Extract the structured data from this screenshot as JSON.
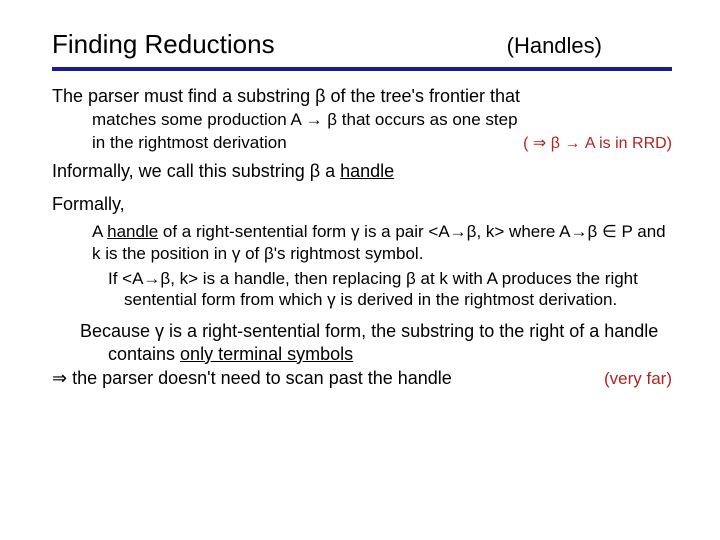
{
  "title": "Finding Reductions",
  "subtitle": "(Handles)",
  "line1": "The parser must find a substring β of the tree's frontier that",
  "line1a": "matches some production A → β that occurs as one step",
  "line1b_left": "in the rightmost derivation",
  "line1b_right": "( ⇒ β → A is in RRD)",
  "line2_a": "Informally, we call this substring β a ",
  "line2_b": "handle",
  "line3": "Formally,",
  "formal1_a": "A ",
  "formal1_b": "handle",
  "formal1_c": " of a right-sentential form γ is a pair <A→β, k> where A→β ∈ P and k is the position in γ of β's rightmost symbol.",
  "formal2": "If <A→β, k> is a handle, then replacing β at k with A produces the right sentential form from which γ is derived in the rightmost derivation.",
  "line4a": "Because γ is a right-sentential form, the substring to the right of a handle contains ",
  "line4b": "only terminal symbols",
  "line5": "⇒ the parser doesn't need to scan past the handle",
  "veryfar": "(very far)"
}
